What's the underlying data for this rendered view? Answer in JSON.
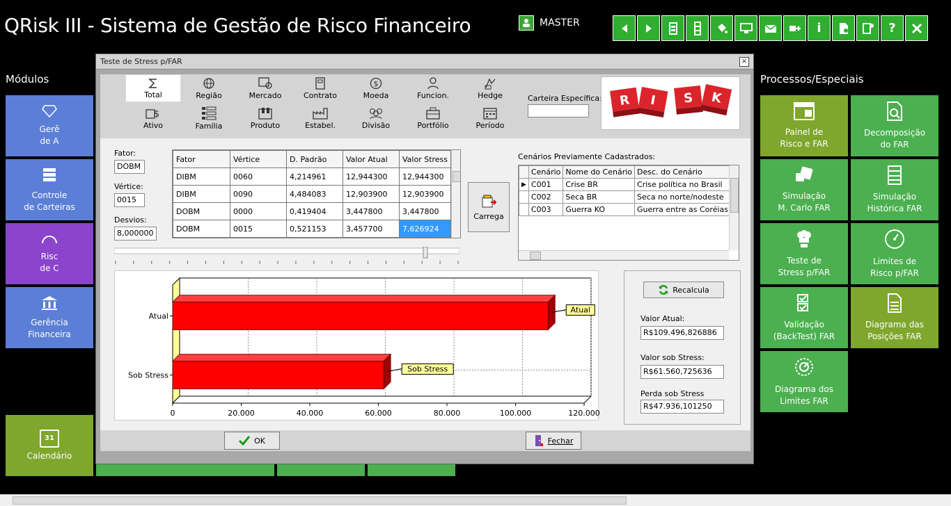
{
  "app": {
    "title": "QRisk III - Sistema de Gestão de Risco Financeiro",
    "user": "MASTER"
  },
  "toolbar": {
    "buttons": [
      "back-icon",
      "forward-icon",
      "level-icon",
      "column-icon",
      "bucket-icon",
      "monitor-icon",
      "mail-icon",
      "export-icon",
      "info-icon",
      "doc-icon",
      "calc-icon",
      "help-icon",
      "close-icon"
    ],
    "info_glyph": "i",
    "help_glyph": "?"
  },
  "modules": {
    "label": "Módulos",
    "tiles": [
      {
        "label1": "Gerê",
        "label2": "de A"
      },
      {
        "label1": "Controle",
        "label2": "de Carteiras"
      },
      {
        "label1": "Risc",
        "label2": "de  C"
      },
      {
        "label1": "Gerência",
        "label2": "Financeira"
      },
      {
        "label1": "Calendário",
        "label2": "",
        "day": "31"
      }
    ]
  },
  "processes": {
    "label": "Processos/Especiais",
    "tiles": [
      {
        "label1": "Painel de",
        "label2": "Risco e FAR"
      },
      {
        "label1": "Decomposição",
        "label2": "do FAR"
      },
      {
        "label1": "Simulação",
        "label2": "M. Carlo FAR"
      },
      {
        "label1": "Simulação",
        "label2": "Histórica FAR"
      },
      {
        "label1": "Teste de",
        "label2": "Stress p/FAR"
      },
      {
        "label1": "Limites de",
        "label2": "Risco p/FAR"
      },
      {
        "label1": "Validação",
        "label2": "(BackTest) FAR"
      },
      {
        "label1": "Diagrama das",
        "label2": "Posições FAR"
      },
      {
        "label1": "Diagrama dos",
        "label2": "Limites FAR"
      }
    ]
  },
  "dialog": {
    "title": "Teste de Stress p/FAR",
    "close_glyph": "×",
    "dimensions": [
      {
        "label": "Total",
        "selected": true
      },
      {
        "label": "Região"
      },
      {
        "label": "Mercado"
      },
      {
        "label": "Contrato"
      },
      {
        "label": "Moeda"
      },
      {
        "label": "Funcion."
      },
      {
        "label": "Hedge"
      },
      {
        "label": "Ativo"
      },
      {
        "label": "Família"
      },
      {
        "label": "Produto"
      },
      {
        "label": "Estabel."
      },
      {
        "label": "Divisão"
      },
      {
        "label": "Portfólio"
      },
      {
        "label": "Período"
      }
    ],
    "carteira_label": "Carteira Específica:",
    "risk_letters": [
      "R",
      "I",
      "S",
      "K"
    ],
    "fields": {
      "fator_label": "Fator:",
      "fator_value": "DOBM",
      "vertice_label": "Vértice:",
      "vertice_value": "0015",
      "desvios_label": "Desvios:",
      "desvios_value": "8,000000"
    },
    "grid": {
      "headers": [
        "Fator",
        "Vértice",
        "D. Padrão",
        "Valor Atual",
        "Valor Stress"
      ],
      "rows": [
        [
          "DIBM",
          "0060",
          "4,214961",
          "12,944300",
          "12,944300"
        ],
        [
          "DIBM",
          "0090",
          "4,484083",
          "12,903900",
          "12,903900"
        ],
        [
          "DOBM",
          "0000",
          "0,419404",
          "3,447800",
          "3,447800"
        ],
        [
          "DOBM",
          "0015",
          "0,521153",
          "3,457700",
          "7,626924"
        ]
      ]
    },
    "carrega_label": "Carrega",
    "scenarios": {
      "label": "Cenários Previamente Cadastrados:",
      "headers": [
        "Cenário",
        "Nome do Cenário",
        "Desc. do Cenário"
      ],
      "rows": [
        [
          "C001",
          "Crise BR",
          "Crise política no Brasil"
        ],
        [
          "C002",
          "Seca BR",
          "Seca no norte/nodeste"
        ],
        [
          "C003",
          "Guerra KO",
          "Guerra entre as Coréias"
        ]
      ]
    },
    "recalcula_label": "Recalcula",
    "valor_atual_label": "Valor Atual:",
    "valor_atual": "R$109.496,826886",
    "valor_stress_label": "Valor sob Stress:",
    "valor_stress": "R$61.560,725636",
    "perda_label": "Perda sob  Stress",
    "perda": "R$47.936,101250",
    "ok_label": "OK",
    "fechar_label": "Fechar"
  },
  "chart_data": {
    "type": "bar",
    "orientation": "horizontal",
    "categories": [
      "Atual",
      "Sob Stress"
    ],
    "values": [
      109496.83,
      61560.73
    ],
    "data_labels": [
      "Atual",
      "Sob Stress"
    ],
    "xlim": [
      0,
      120000
    ],
    "ticks": [
      "0",
      "20.000",
      "40.000",
      "60.000",
      "80.000",
      "100.000",
      "120.000"
    ],
    "grid": true,
    "bar_color": "#ff0000"
  }
}
